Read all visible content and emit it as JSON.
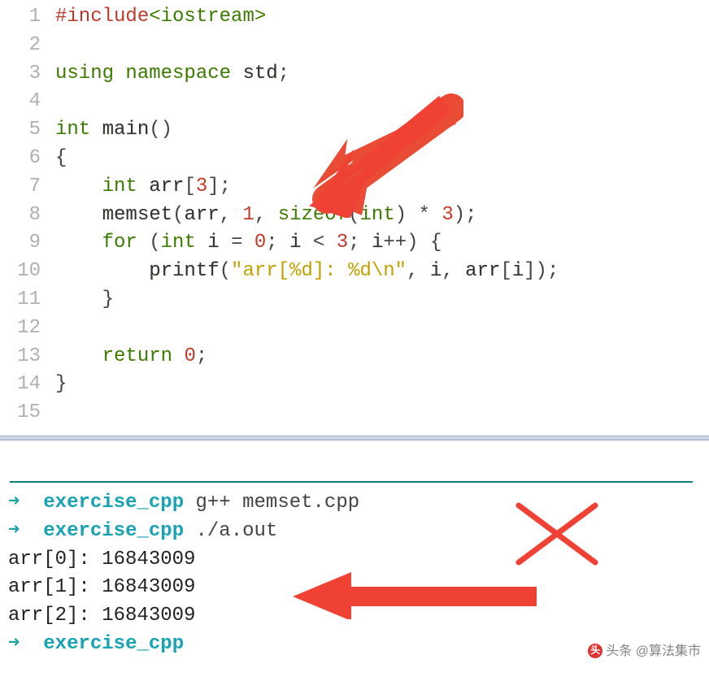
{
  "code": {
    "lines": [
      {
        "n": "1",
        "tokens": [
          [
            "inc",
            "#include"
          ],
          [
            "hdr",
            "<iostream>"
          ]
        ]
      },
      {
        "n": "2",
        "tokens": []
      },
      {
        "n": "3",
        "tokens": [
          [
            "kw",
            "using"
          ],
          [
            "",
            ", "
          ],
          [
            "kw",
            "namespace"
          ],
          [
            "",
            ", "
          ],
          [
            "id",
            "std"
          ],
          [
            "punct",
            ";"
          ]
        ]
      },
      {
        "n": "4",
        "tokens": []
      },
      {
        "n": "5",
        "tokens": [
          [
            "kw",
            "int"
          ],
          [
            "",
            ", "
          ],
          [
            "id",
            "main"
          ],
          [
            "punct",
            "()"
          ]
        ]
      },
      {
        "n": "6",
        "tokens": [
          [
            "punct",
            "{"
          ]
        ]
      },
      {
        "n": "7",
        "tokens": [
          [
            "",
            "    "
          ],
          [
            "kw",
            "int"
          ],
          [
            "",
            ", "
          ],
          [
            "id",
            "arr"
          ],
          [
            "punct",
            "["
          ],
          [
            "num",
            "3"
          ],
          [
            "punct",
            "];"
          ]
        ]
      },
      {
        "n": "8",
        "tokens": [
          [
            "",
            "    "
          ],
          [
            "id",
            "memset"
          ],
          [
            "punct",
            "("
          ],
          [
            "id",
            "arr"
          ],
          [
            "punct",
            ", "
          ],
          [
            "num",
            "1"
          ],
          [
            "punct",
            ", "
          ],
          [
            "kw",
            "sizeof"
          ],
          [
            "punct",
            "("
          ],
          [
            "kw",
            "int"
          ],
          [
            "punct",
            ") * "
          ],
          [
            "num",
            "3"
          ],
          [
            "punct",
            ");"
          ]
        ]
      },
      {
        "n": "9",
        "tokens": [
          [
            "",
            "    "
          ],
          [
            "kw",
            "for"
          ],
          [
            "",
            ", "
          ],
          [
            "punct",
            "("
          ],
          [
            "kw",
            "int"
          ],
          [
            "",
            ", "
          ],
          [
            "id",
            "i"
          ],
          [
            "punct",
            " = "
          ],
          [
            "num",
            "0"
          ],
          [
            "punct",
            "; "
          ],
          [
            "id",
            "i"
          ],
          [
            "punct",
            " < "
          ],
          [
            "num",
            "3"
          ],
          [
            "punct",
            "; "
          ],
          [
            "id",
            "i"
          ],
          [
            "punct",
            "++) {"
          ]
        ]
      },
      {
        "n": "10",
        "tokens": [
          [
            "",
            "        "
          ],
          [
            "id",
            "printf"
          ],
          [
            "punct",
            "("
          ],
          [
            "str",
            "\"arr[%d]: %d\\n\""
          ],
          [
            "punct",
            ", "
          ],
          [
            "id",
            "i"
          ],
          [
            "punct",
            ", "
          ],
          [
            "id",
            "arr"
          ],
          [
            "punct",
            "["
          ],
          [
            "id",
            "i"
          ],
          [
            "punct",
            "]);"
          ]
        ]
      },
      {
        "n": "11",
        "tokens": [
          [
            "",
            "    "
          ],
          [
            "punct",
            "}"
          ]
        ]
      },
      {
        "n": "12",
        "tokens": []
      },
      {
        "n": "13",
        "tokens": [
          [
            "",
            "    "
          ],
          [
            "kw",
            "return"
          ],
          [
            "",
            ", "
          ],
          [
            "num",
            "0"
          ],
          [
            "punct",
            ";"
          ]
        ]
      },
      {
        "n": "14",
        "tokens": [
          [
            "punct",
            "}"
          ]
        ]
      },
      {
        "n": "15",
        "tokens": []
      }
    ]
  },
  "terminal": {
    "lines": [
      {
        "arrow": "➜  ",
        "dir": "exercise_cpp ",
        "cmd": "g++ memset.cpp"
      },
      {
        "arrow": "➜  ",
        "dir": "exercise_cpp ",
        "cmd": "./a.out"
      },
      {
        "out": "arr[0]: 16843009"
      },
      {
        "out": "arr[1]: 16843009"
      },
      {
        "out": "arr[2]: 16843009"
      },
      {
        "arrow": "➜  ",
        "dir": "exercise_cpp",
        "cmd": ""
      }
    ]
  },
  "watermark": {
    "label": "头条 @算法集市"
  },
  "icons": {
    "arrow1": "red-arrow",
    "arrow2": "red-arrow",
    "cross": "red-cross"
  }
}
